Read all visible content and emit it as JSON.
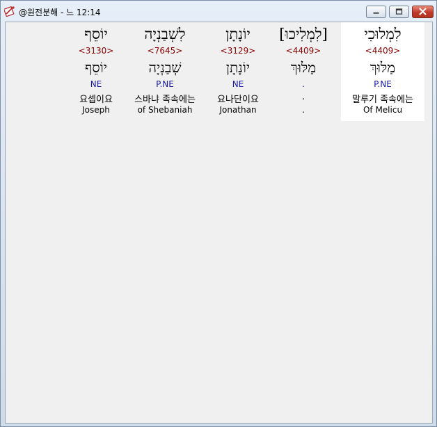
{
  "window": {
    "title": "@원전분해 - 느 12:14",
    "controls": [
      "minimize-icon",
      "maximize-icon",
      "close-icon"
    ],
    "close_color": "#c0392b"
  },
  "colors": {
    "strong": "#8b0000",
    "pos": "#1a1aaa",
    "selected_bg": "#ffffff"
  },
  "words": [
    {
      "hebrew": "יוֹסֵף",
      "strong": "<3130>",
      "root": "יוֹסֵף",
      "pos": "NE",
      "korean": "요셉이요",
      "english": "Joseph"
    },
    {
      "hebrew": "לִשְׁבַנְיָה",
      "strong": "<7645>",
      "root": "שְׁבַנְיָה",
      "pos": "P.NE",
      "korean": "스바냐 족속에는",
      "english": "of Shebaniah"
    },
    {
      "hebrew": "יוֹנָתָן",
      "strong": "<3129>",
      "root": "יוֹנָתָן",
      "pos": "NE",
      "korean": "요나단이요",
      "english": "Jonathan"
    },
    {
      "hebrew": "[לִמְלִיכוּ]",
      "strong": "<4409>",
      "root": "מַלּוּךְ",
      "pos": ".",
      "korean": ".",
      "english": "."
    },
    {
      "hebrew": "לִמְלוּכִי",
      "strong": "<4409>",
      "root": "מַלּוּךְ",
      "pos": "P.NE",
      "korean": "말루기 족속에는",
      "english": "Of Melicu",
      "selected": true
    }
  ]
}
